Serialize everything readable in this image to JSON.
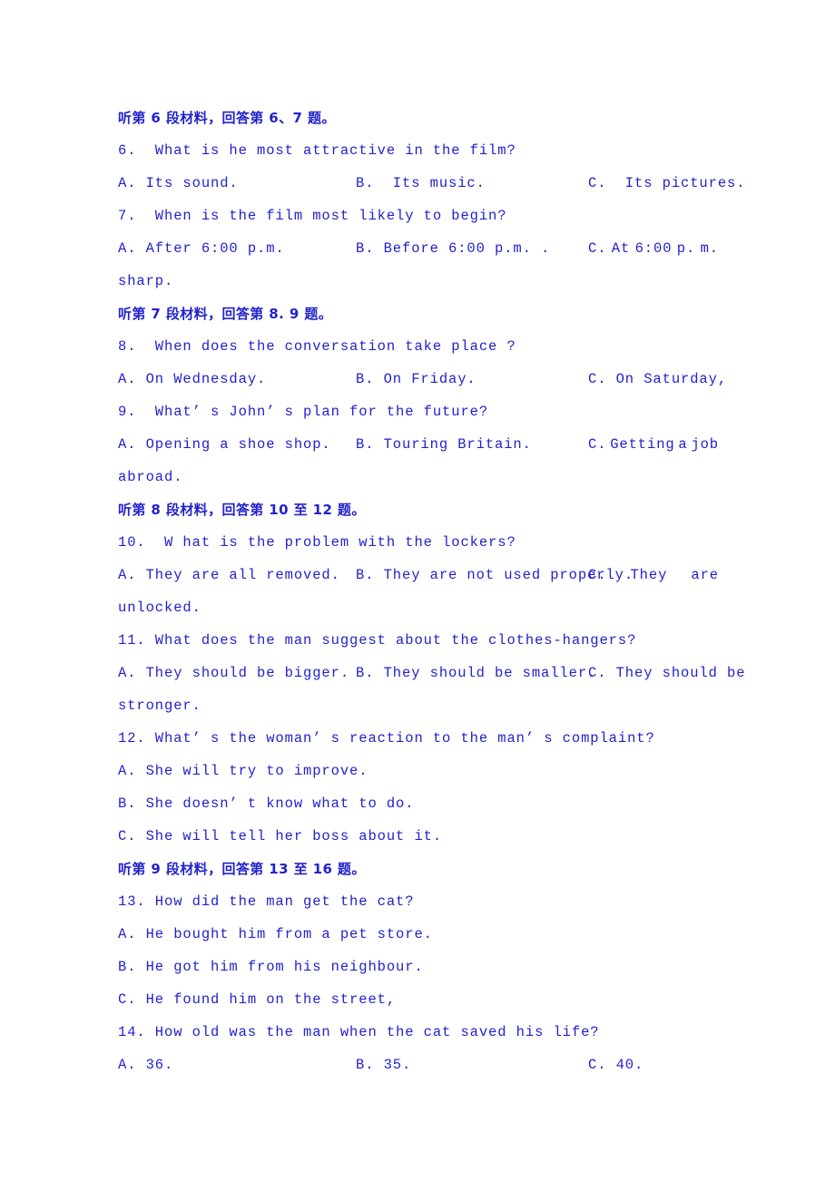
{
  "document": {
    "type": "listening-comprehension-exam",
    "language": "zh-CN/en",
    "text_color": "#2222cc",
    "background_color": "#ffffff"
  },
  "blocks": [
    {
      "id": "section-6-7",
      "header": "听第 6 段材料，回答第 6、7 题。",
      "questions": [
        {
          "number": "6.",
          "stem": "6.  What is he most attractive in the film?",
          "options_row": {
            "a": "A. Its sound.",
            "b": "B.  Its music.",
            "c": "C.  Its pictures."
          }
        },
        {
          "number": "7.",
          "stem": "7.  When is the film most likely to begin?",
          "options_row": {
            "a": "A. After 6:00 p.m.",
            "b": "B. Before 6:00 p.m. .",
            "c_parts": [
              "C.",
              "At",
              "6:00",
              "p.",
              "m."
            ]
          },
          "continuation": "sharp."
        }
      ]
    },
    {
      "id": "section-8-9",
      "header": "听第 7 段材料，回答第 8. 9 题。",
      "questions": [
        {
          "number": "8.",
          "stem": "8.  When does the conversation take place ?",
          "options_row": {
            "a": "A. On Wednesday.",
            "b": "B. On Friday.",
            "c": "C. On Saturday,"
          }
        },
        {
          "number": "9.",
          "stem": "9.  What’ s John’ s plan for the future?",
          "options_row": {
            "a": "A. Opening a shoe shop.",
            "b": "B. Touring Britain.",
            "c_parts": [
              "C.",
              "Getting",
              "a",
              "job"
            ]
          },
          "continuation": "abroad."
        }
      ]
    },
    {
      "id": "section-10-12",
      "header": "听第 8 段材料，回答第 10 至 12 题。",
      "questions": [
        {
          "number": "10.",
          "stem": "10.  W hat is the problem with the lockers?",
          "options_row": {
            "a": "A. They are all removed.",
            "b": "B. They are not used properly.",
            "c_parts": [
              "C.",
              "They",
              "are"
            ]
          },
          "continuation": "unlocked."
        },
        {
          "number": "11.",
          "stem": "11. What does the man suggest about the clothes-hangers?",
          "options_row": {
            "a": "A. They should be bigger.",
            "b": "B. They should be smaller.",
            "c": "C. They should be"
          },
          "continuation": "stronger."
        },
        {
          "number": "12.",
          "stem": "12. What’ s the woman’ s reaction to the man’ s complaint?",
          "options_stacked": [
            "A. She will try to improve.",
            "B. She doesn’ t know what to do.",
            "C. She will tell her boss about it."
          ]
        }
      ]
    },
    {
      "id": "section-13-16",
      "header": "听第 9 段材料，回答第 13 至 16 题。",
      "questions": [
        {
          "number": "13.",
          "stem": "13. How did the man get the cat?",
          "options_stacked": [
            "A. He bought him from a pet store.",
            "B. He got him from his neighbour.",
            "C. He found him on the street,"
          ]
        },
        {
          "number": "14.",
          "stem": "14. How old was the man when the cat saved his life?",
          "options_row": {
            "a": "A. 36.",
            "b": "B. 35.",
            "c": "C. 40."
          }
        }
      ]
    }
  ]
}
